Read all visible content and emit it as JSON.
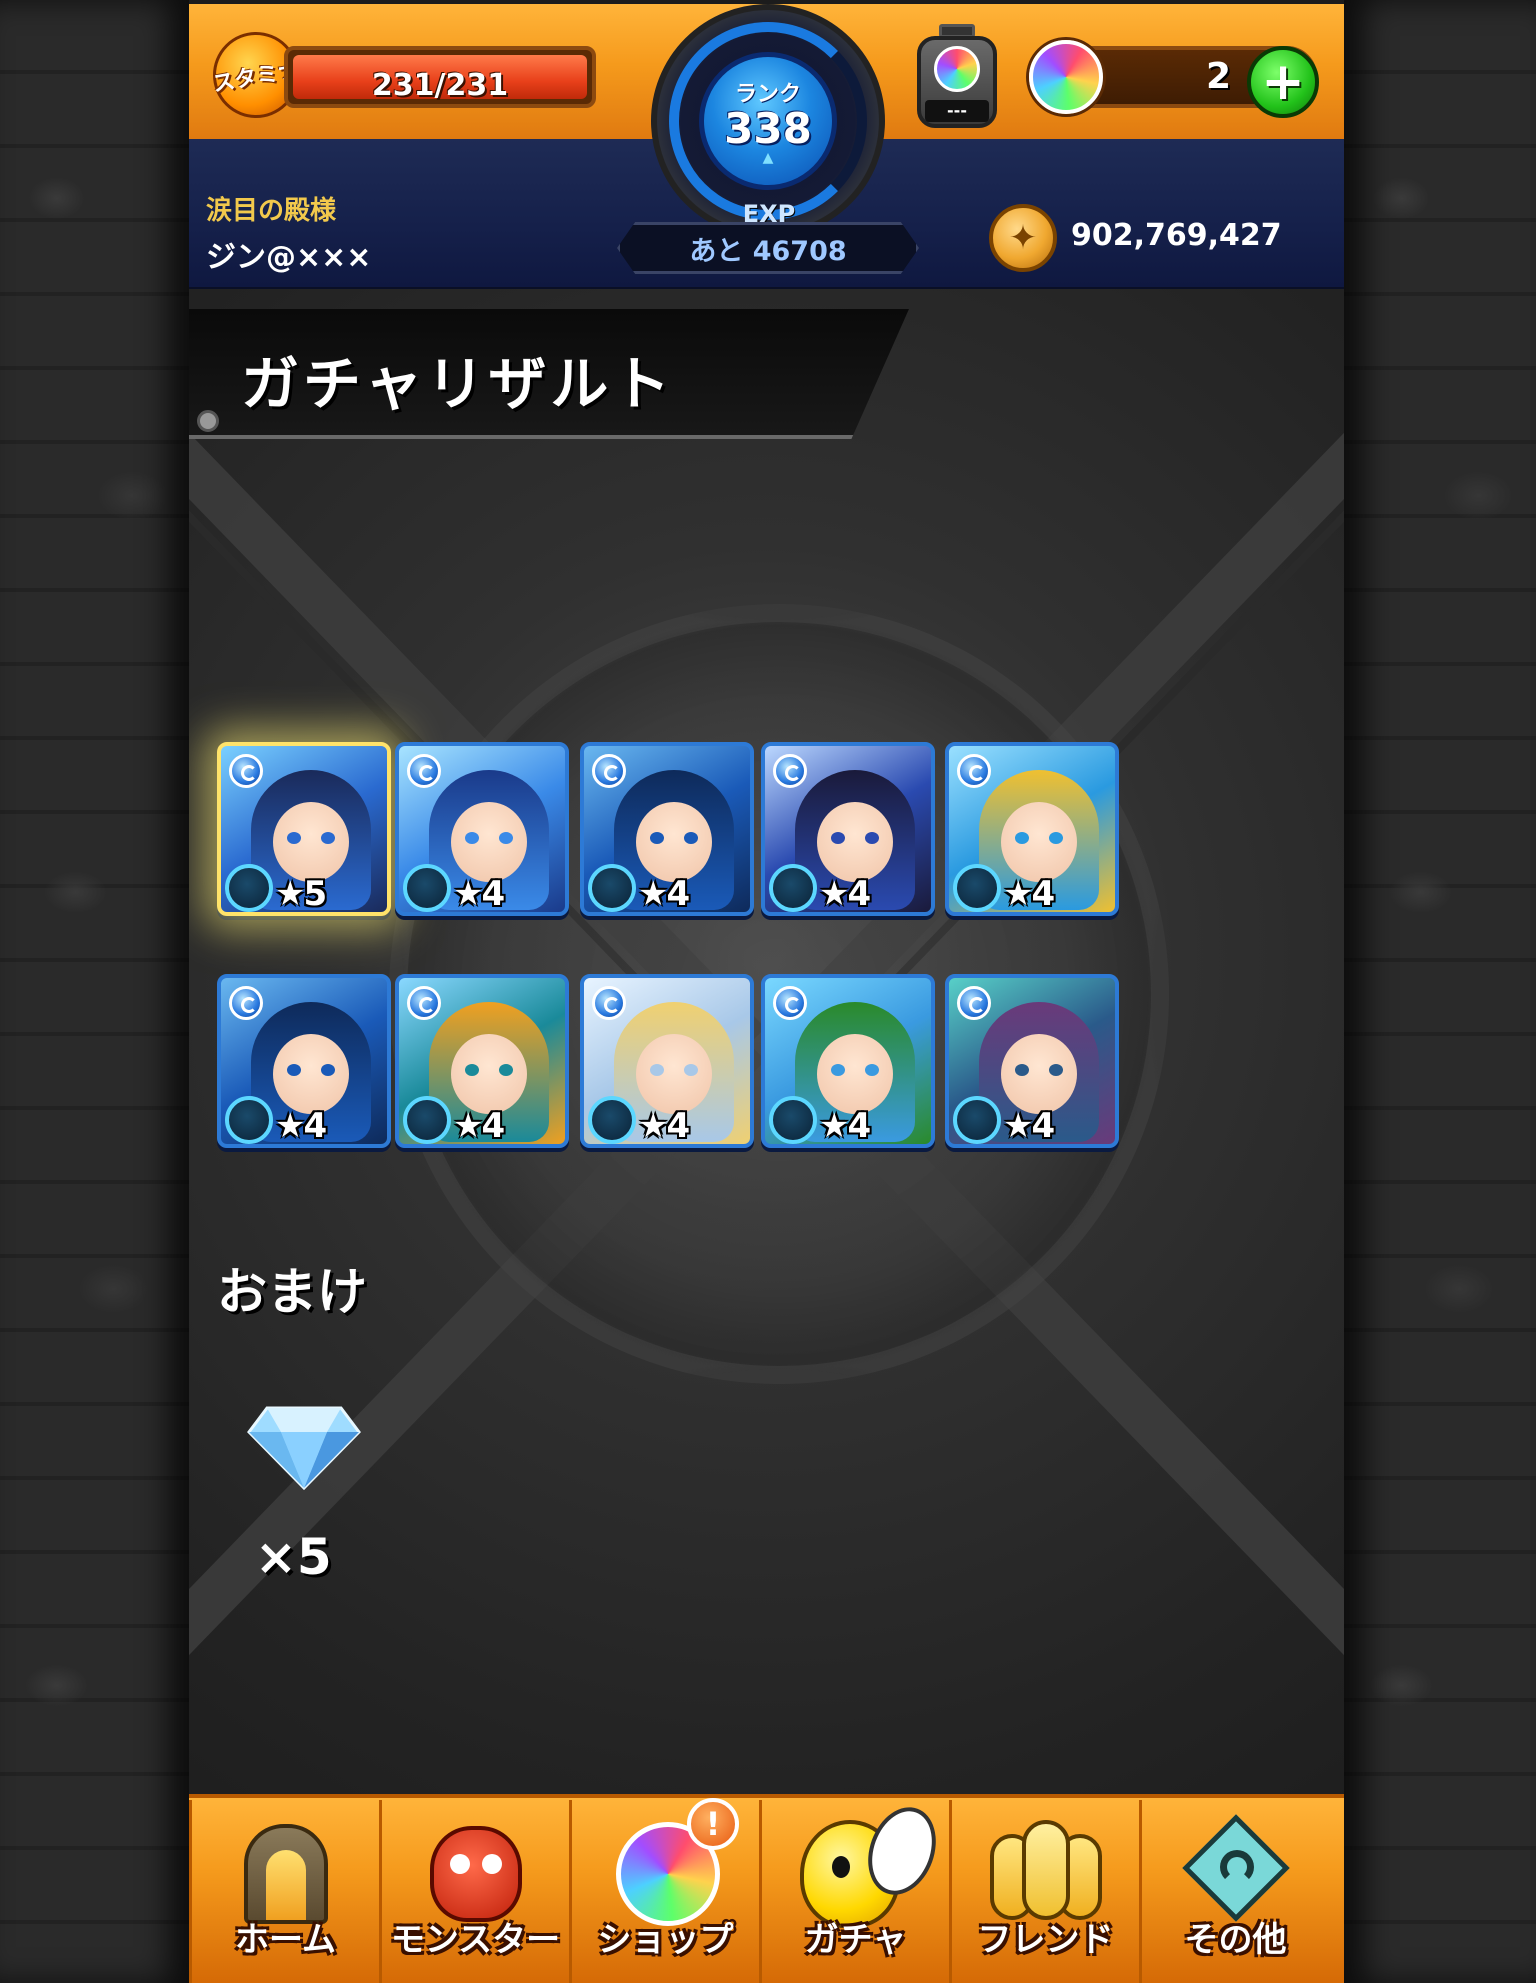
{
  "header": {
    "stamina_label": "スタミナ",
    "stamina_value": "231/231",
    "stamina_fraction": 1.0,
    "rank_label": "ランク",
    "rank_value": "338",
    "exp_label": "EXP",
    "exp_remaining": "あと 46708",
    "timer_value": "---",
    "orb_count": "2",
    "plus_label": "+",
    "title": "涙目の殿様",
    "username": "ジン@×××",
    "gold": "902,769,427"
  },
  "section": {
    "title": "ガチャリザルト"
  },
  "results": [
    {
      "rarity": "★5",
      "icon": "monster-portrait",
      "highlight": true,
      "palette": [
        "#7ad0ff",
        "#2a6ad0",
        "#1a2a5a"
      ]
    },
    {
      "rarity": "★4",
      "icon": "monster-portrait",
      "highlight": false,
      "palette": [
        "#a8e4ff",
        "#3a8ae8",
        "#1a3a8a"
      ]
    },
    {
      "rarity": "★4",
      "icon": "monster-portrait",
      "highlight": false,
      "palette": [
        "#6ab8f0",
        "#1a5ab8",
        "#0e2a5a"
      ]
    },
    {
      "rarity": "★4",
      "icon": "monster-portrait",
      "highlight": false,
      "palette": [
        "#bcd8ff",
        "#2a4ab0",
        "#1a1a3a"
      ]
    },
    {
      "rarity": "★4",
      "icon": "monster-portrait",
      "highlight": false,
      "palette": [
        "#9ae0ff",
        "#2a9ae0",
        "#f0c030"
      ]
    },
    {
      "rarity": "★4",
      "icon": "monster-portrait",
      "highlight": false,
      "palette": [
        "#6ab8f0",
        "#1a5ab8",
        "#0e2a5a"
      ]
    },
    {
      "rarity": "★4",
      "icon": "monster-portrait",
      "highlight": false,
      "palette": [
        "#8ad8ff",
        "#1a8a9a",
        "#f0a020"
      ]
    },
    {
      "rarity": "★4",
      "icon": "monster-portrait",
      "highlight": false,
      "palette": [
        "#e8f4ff",
        "#a8c8e8",
        "#f0d070"
      ]
    },
    {
      "rarity": "★4",
      "icon": "monster-portrait",
      "highlight": false,
      "palette": [
        "#7ad8ff",
        "#3a9ae0",
        "#2a8a2a"
      ]
    },
    {
      "rarity": "★4",
      "icon": "monster-portrait",
      "highlight": false,
      "palette": [
        "#58d0c8",
        "#2a5a8a",
        "#6a3a7a"
      ]
    }
  ],
  "bonus": {
    "title": "おまけ",
    "item_icon": "gem-icon",
    "item_count": "×5"
  },
  "nav": [
    {
      "label": "ホーム",
      "icon": "home-gate-icon"
    },
    {
      "label": "モンスター",
      "icon": "monster-icon"
    },
    {
      "label": "ショップ",
      "icon": "orb-icon"
    },
    {
      "label": "ガチャ",
      "icon": "gacha-egg-icon"
    },
    {
      "label": "フレンド",
      "icon": "friends-icon"
    },
    {
      "label": "その他",
      "icon": "other-icon"
    }
  ],
  "shop_alert": "!"
}
